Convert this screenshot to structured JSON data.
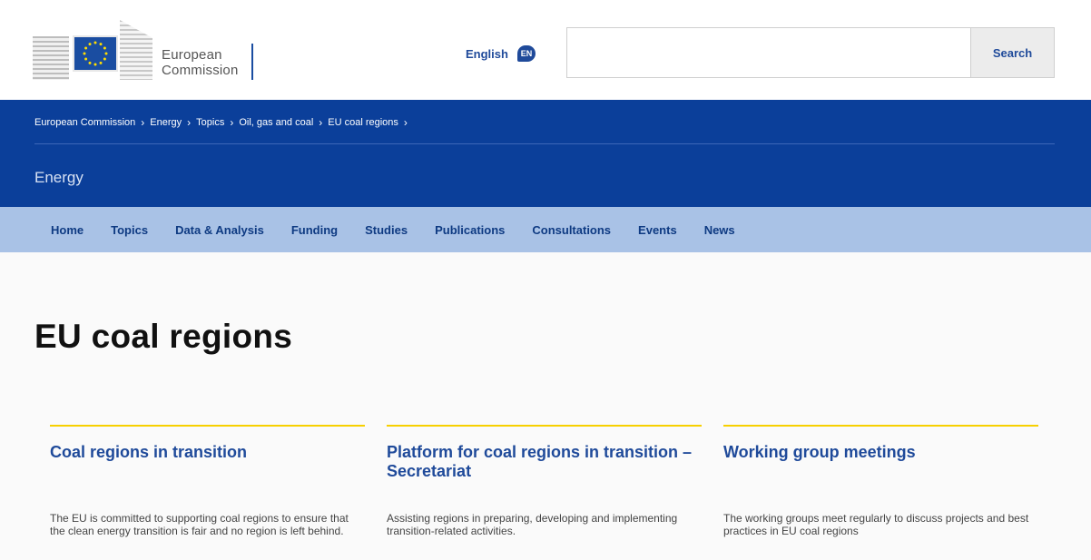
{
  "header": {
    "logo_text_line1": "European",
    "logo_text_line2": "Commission",
    "language_label": "English",
    "language_code": "EN",
    "search_value": "",
    "search_button": "Search"
  },
  "breadcrumb": [
    "European Commission",
    "Energy",
    "Topics",
    "Oil, gas and coal",
    "EU coal regions"
  ],
  "site_name": "Energy",
  "nav": [
    "Home",
    "Topics",
    "Data & Analysis",
    "Funding",
    "Studies",
    "Publications",
    "Consultations",
    "Events",
    "News"
  ],
  "page_title": "EU coal regions",
  "cards": [
    {
      "title": "Coal regions in transition",
      "description": "The EU is committed to supporting coal regions to ensure that the clean energy transition is fair and no region is left behind."
    },
    {
      "title": "Platform for coal regions in transition – Secretariat",
      "description": "Assisting regions in preparing, developing and implementing transition-related activities."
    },
    {
      "title": "Working group meetings",
      "description": "The working groups meet regularly to discuss projects and best practices in EU coal regions"
    }
  ],
  "colors": {
    "brand_blue": "#0b3f9a",
    "nav_blue": "#a9c2e6",
    "accent_yellow": "#f7d000",
    "link_blue": "#1f4a9a"
  }
}
